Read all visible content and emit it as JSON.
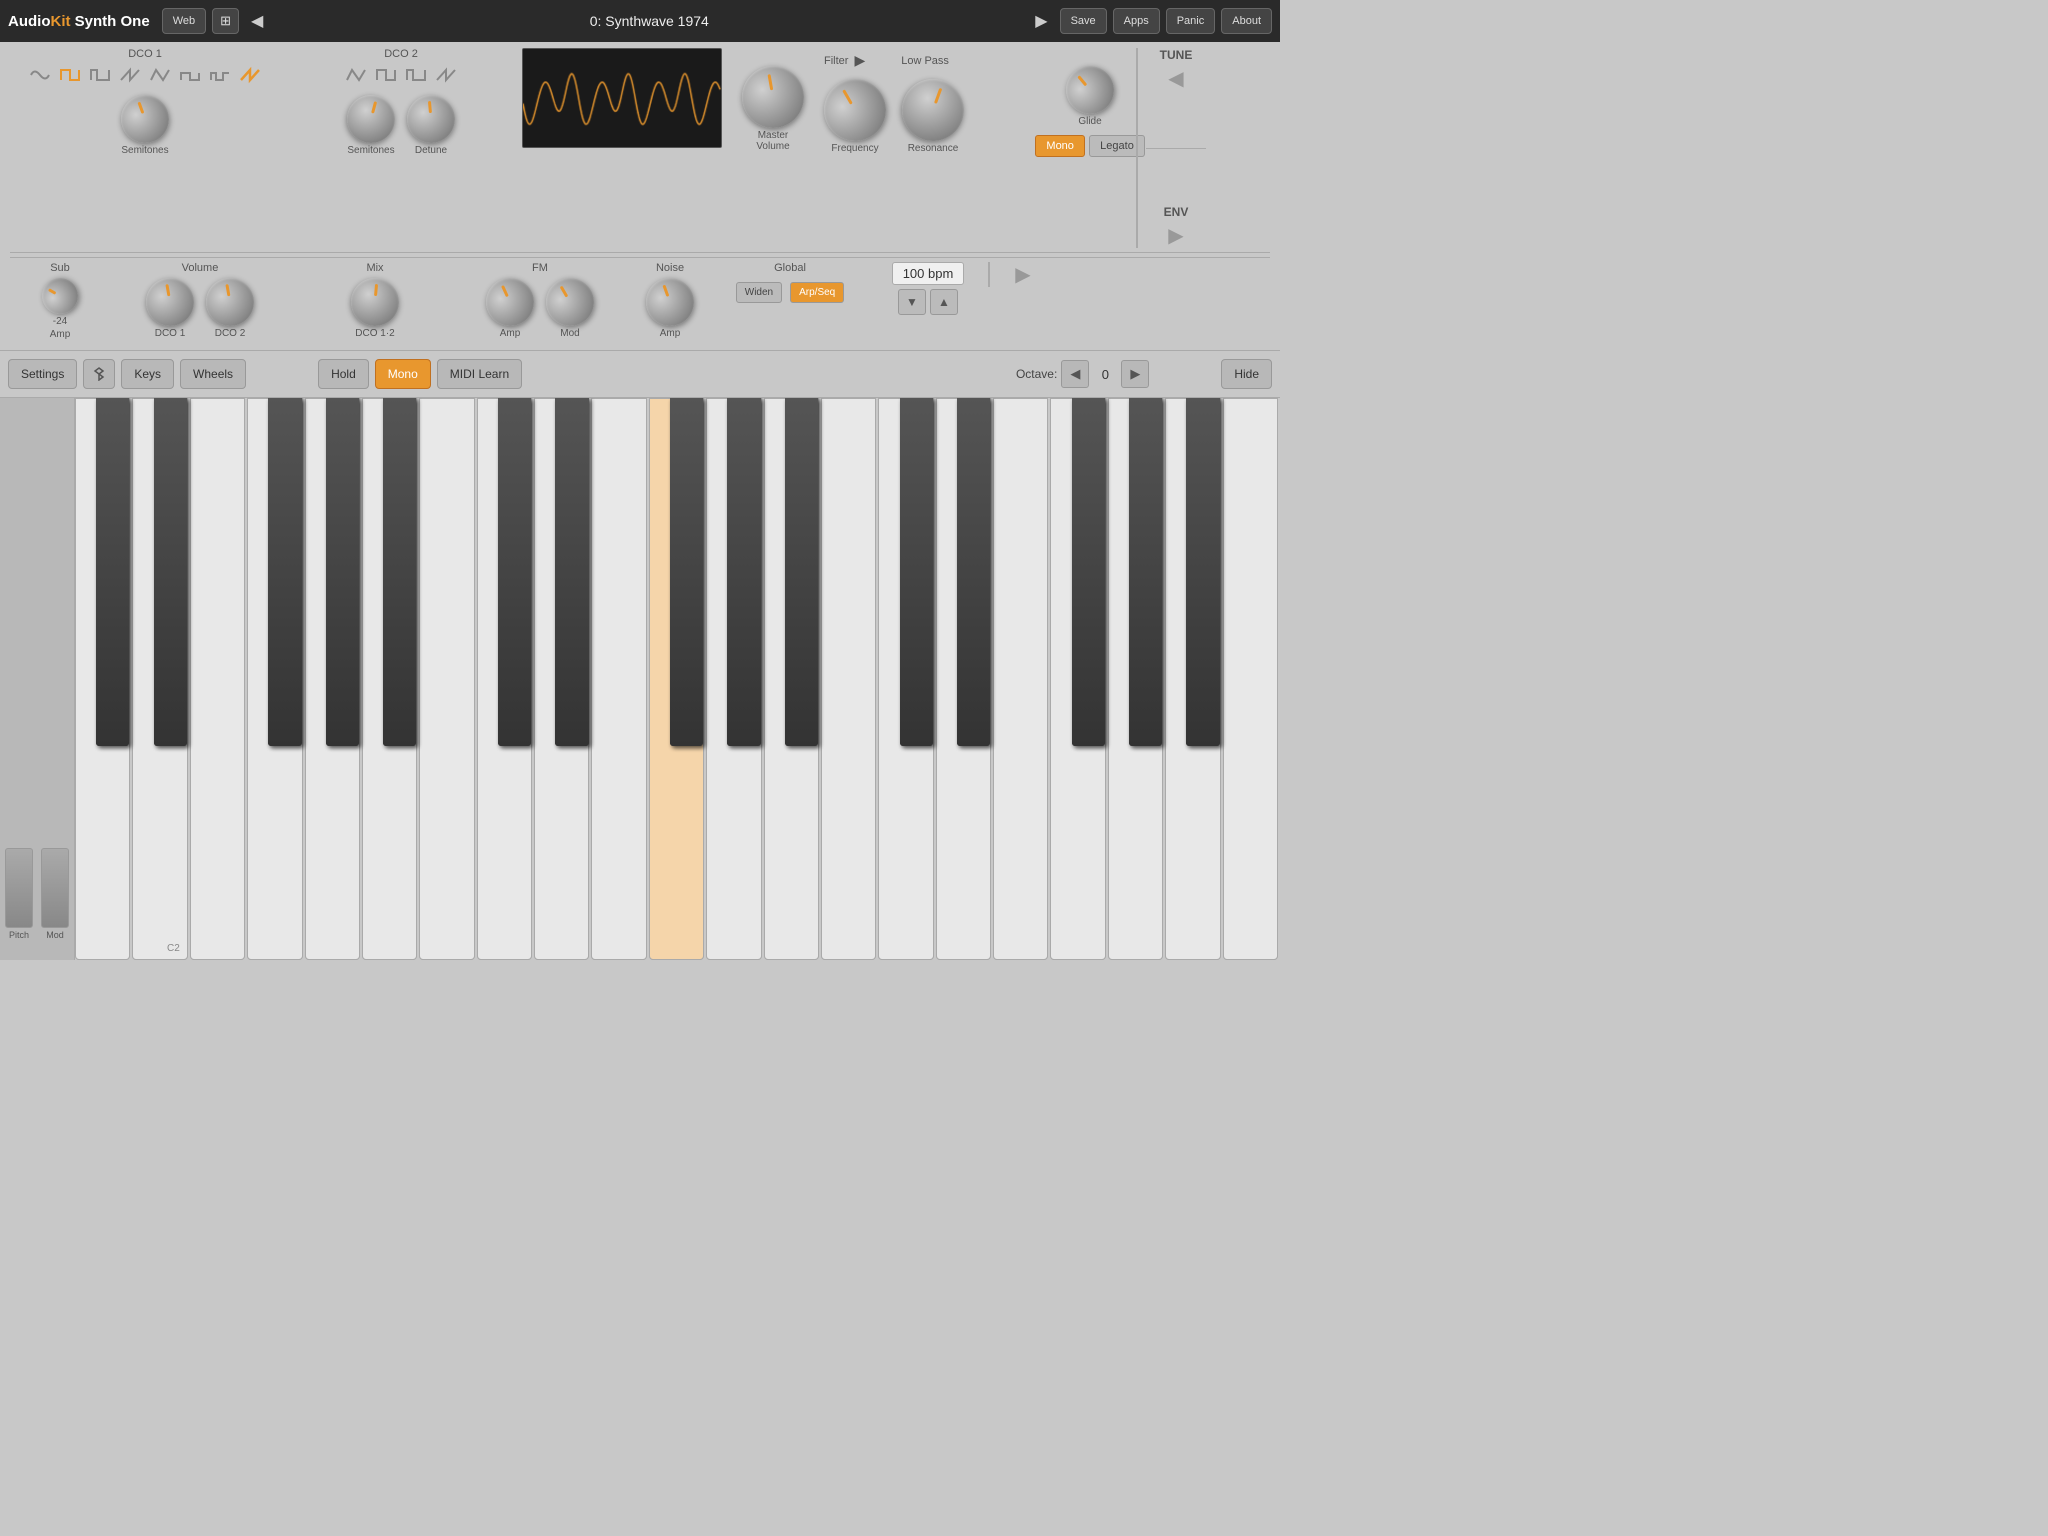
{
  "app": {
    "title_audio": "Audio",
    "title_kit": "Kit",
    "title_synth": "Synth One",
    "web_btn": "Web",
    "preset_name": "0: Synthwave 1974",
    "save_btn": "Save",
    "apps_btn": "Apps",
    "panic_btn": "Panic",
    "about_btn": "About"
  },
  "dco1": {
    "label": "DCO 1",
    "waves": [
      "sine",
      "square",
      "pulse",
      "saw",
      "tri",
      "sqr2",
      "pulse2",
      "saw2"
    ],
    "semitones_label": "Semitones",
    "active_wave": 1
  },
  "dco2": {
    "label": "DCO 2",
    "waves": [
      "tri",
      "sqr",
      "pulse",
      "saw"
    ],
    "semitones_label": "Semitones",
    "detune_label": "Detune",
    "active_wave": 0
  },
  "master_volume": {
    "label": "Master\nVolume"
  },
  "filter": {
    "label": "Filter",
    "type": "Low Pass",
    "frequency_label": "Frequency",
    "resonance_label": "Resonance"
  },
  "glide": {
    "label": "Glide"
  },
  "tune": {
    "label": "TUNE"
  },
  "sub": {
    "label": "Sub",
    "value": "-24",
    "amp_label": "Amp"
  },
  "volume": {
    "label": "Volume",
    "dco1_label": "DCO 1",
    "dco2_label": "DCO 2"
  },
  "mix": {
    "label": "Mix",
    "dco12_label": "DCO 1·2"
  },
  "fm": {
    "label": "FM",
    "amp_label": "Amp",
    "mod_label": "Mod"
  },
  "noise": {
    "label": "Noise",
    "amp_label": "Amp"
  },
  "global": {
    "label": "Global",
    "widen_label": "Widen",
    "arpseq_label": "Arp/Seq"
  },
  "bpm": {
    "value": "100 bpm"
  },
  "mono": {
    "label": "Mono"
  },
  "legato": {
    "label": "Legato"
  },
  "env": {
    "label": "ENV"
  },
  "controls": {
    "settings": "Settings",
    "bluetooth": "bluetooth",
    "keys": "Keys",
    "wheels": "Wheels",
    "hold": "Hold",
    "mono": "Mono",
    "midi_learn": "MIDI Learn",
    "octave_label": "Octave:",
    "octave_value": "0",
    "hide": "Hide"
  },
  "keyboard": {
    "pressed_key": "C4",
    "pitch_label": "Pitch",
    "mod_label": "Mod",
    "c2_label": "C2"
  },
  "colors": {
    "orange": "#e8972e",
    "bg": "#c8c8c8",
    "dark": "#2a2a2a",
    "pressed_key": "#f5d5aa"
  }
}
